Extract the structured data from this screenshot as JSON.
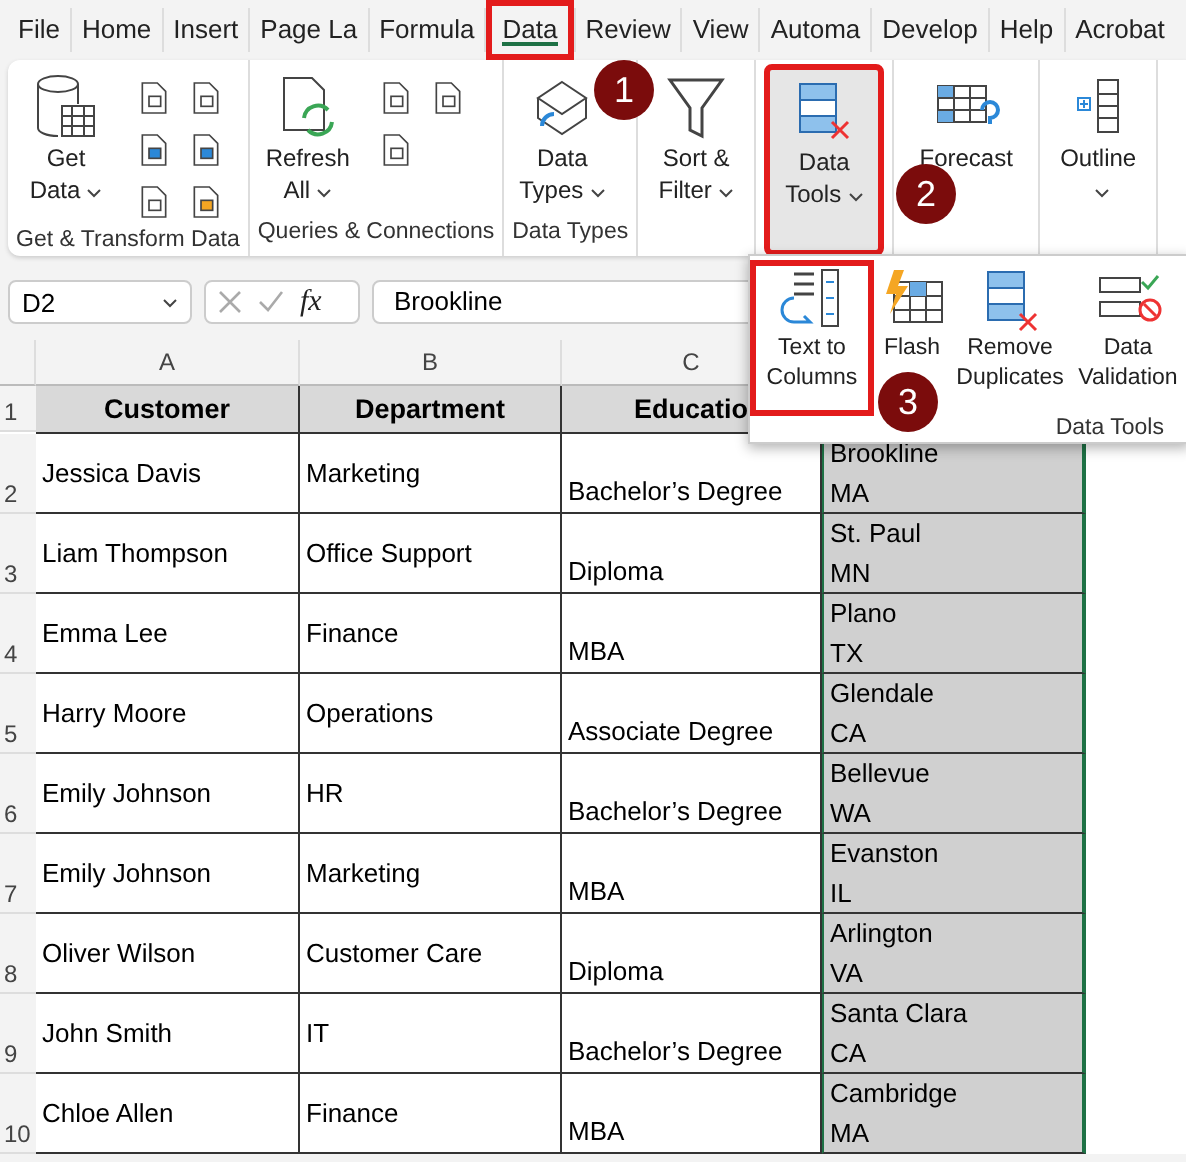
{
  "menu_tabs": [
    {
      "label": "File",
      "selected": false,
      "highlighted": false
    },
    {
      "label": "Home",
      "selected": false,
      "highlighted": false
    },
    {
      "label": "Insert",
      "selected": false,
      "highlighted": false
    },
    {
      "label": "Page La",
      "selected": false,
      "highlighted": false
    },
    {
      "label": "Formula",
      "selected": false,
      "highlighted": false
    },
    {
      "label": "Data",
      "selected": true,
      "highlighted": true
    },
    {
      "label": "Review",
      "selected": false,
      "highlighted": false
    },
    {
      "label": "View",
      "selected": false,
      "highlighted": false
    },
    {
      "label": "Automa",
      "selected": false,
      "highlighted": false
    },
    {
      "label": "Develop",
      "selected": false,
      "highlighted": false
    },
    {
      "label": "Help",
      "selected": false,
      "highlighted": false
    },
    {
      "label": "Acrobat",
      "selected": false,
      "highlighted": false
    }
  ],
  "ribbon_groups": [
    {
      "label": "Get & Transform Data",
      "large": {
        "label": "Get Data",
        "caret": true,
        "pressed": false,
        "highlighted": false
      }
    },
    {
      "label": "Queries & Connections",
      "large": {
        "label": "Refresh All",
        "caret": true,
        "pressed": false,
        "highlighted": false
      }
    },
    {
      "label": "Data Types",
      "large": {
        "label": "Data Types",
        "caret": true,
        "pressed": false,
        "highlighted": false
      }
    },
    {
      "large": {
        "label": "Sort & Filter",
        "caret": true,
        "pressed": false,
        "highlighted": false
      }
    },
    {
      "large": {
        "label": "Data Tools",
        "caret": true,
        "pressed": true,
        "highlighted": true
      }
    },
    {
      "large": {
        "label": "Forecast",
        "caret": false,
        "pressed": false,
        "highlighted": false
      }
    },
    {
      "large": {
        "label": "Outline",
        "caret": true,
        "pressed": false,
        "highlighted": false
      }
    }
  ],
  "formula_bar": {
    "name_box": "D2",
    "function_label": "fx",
    "formula": "Brookline"
  },
  "data_tools_popup": {
    "label": "Data Tools",
    "buttons": [
      {
        "label": "Text to Columns",
        "highlighted": true
      },
      {
        "label": "Flash",
        "highlighted": false
      },
      {
        "label": "Remove Duplicates",
        "highlighted": false
      },
      {
        "label": "Data Validation",
        "highlighted": false
      }
    ]
  },
  "steps": [
    "1",
    "2",
    "3"
  ],
  "sheet": {
    "column_headers": [
      "A",
      "B",
      "C"
    ],
    "row_numbers": [
      "1",
      "2",
      "3",
      "4",
      "5",
      "6",
      "7",
      "8",
      "9",
      "10"
    ],
    "header_cells": [
      "Customer",
      "Department",
      "Educatio"
    ],
    "rows": [
      [
        "Jessica Davis",
        "Marketing",
        "Bachelor’s Degree",
        "Brookline\nMA"
      ],
      [
        "Liam Thompson",
        "Office Support",
        "Diploma",
        "St. Paul\nMN"
      ],
      [
        "Emma Lee",
        "Finance",
        "MBA",
        "Plano\nTX"
      ],
      [
        "Harry Moore",
        "Operations",
        "Associate Degree",
        "Glendale\nCA"
      ],
      [
        "Emily Johnson",
        "HR",
        "Bachelor’s Degree",
        "Bellevue\nWA"
      ],
      [
        "Emily Johnson",
        "Marketing",
        "MBA",
        "Evanston\nIL"
      ],
      [
        "Oliver Wilson",
        "Customer Care",
        "Diploma",
        "Arlington\nVA"
      ],
      [
        "John Smith",
        "IT",
        "Bachelor’s Degree",
        "Santa Clara\nCA"
      ],
      [
        "Chloe Allen",
        "Finance",
        "MBA",
        "Cambridge\nMA"
      ]
    ]
  }
}
